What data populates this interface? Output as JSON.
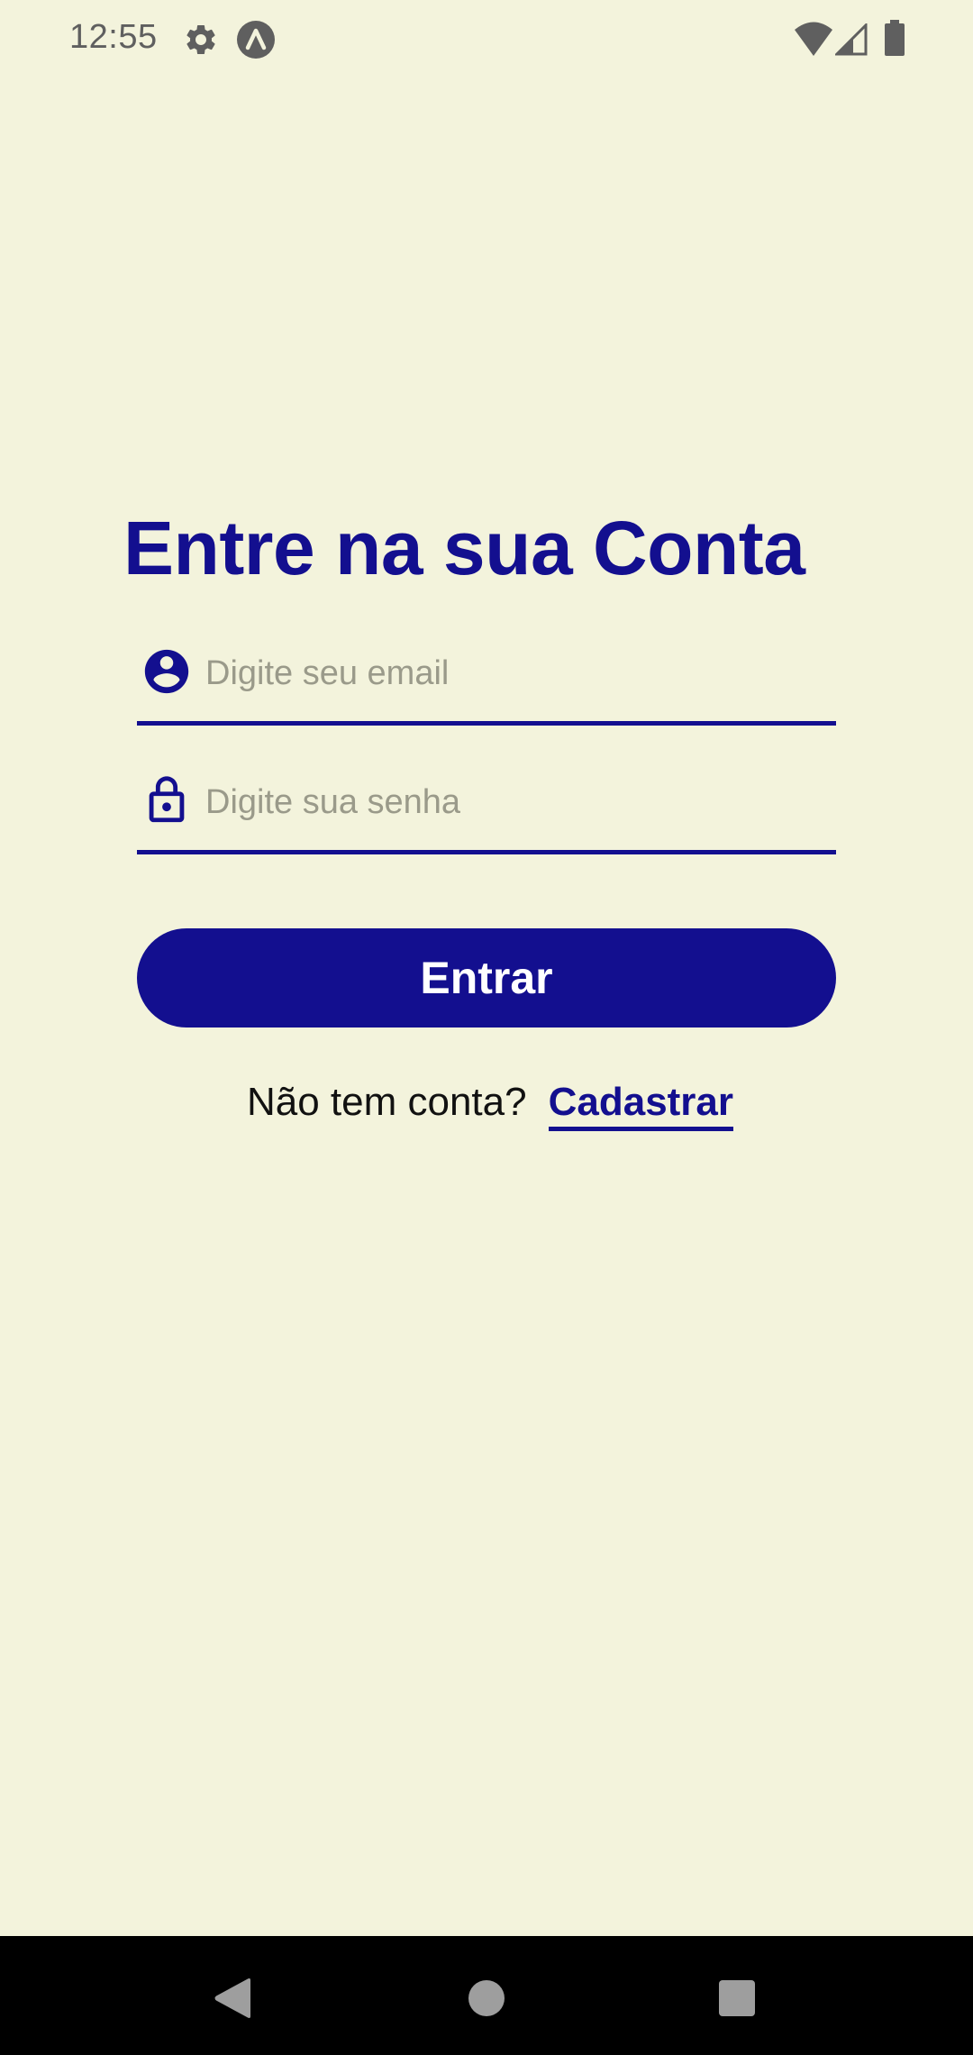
{
  "status_bar": {
    "time": "12:55",
    "icons": [
      "gear-icon",
      "a-circle-icon",
      "wifi-icon",
      "signal-icon",
      "battery-icon"
    ]
  },
  "login": {
    "title": "Entre na sua Conta",
    "email": {
      "placeholder": "Digite seu email",
      "value": "",
      "icon": "account-circle-icon"
    },
    "password": {
      "placeholder": "Digite sua senha",
      "value": "",
      "icon": "lock-icon"
    },
    "submit_label": "Entrar",
    "signup_prompt": "Não tem conta?",
    "signup_link": "Cadastrar"
  },
  "nav_bar": {
    "icons": [
      "back-icon",
      "home-icon",
      "recents-icon"
    ]
  },
  "colors": {
    "background": "#F3F3DC",
    "accent": "#130F8F",
    "nav_bar": "#000000"
  }
}
